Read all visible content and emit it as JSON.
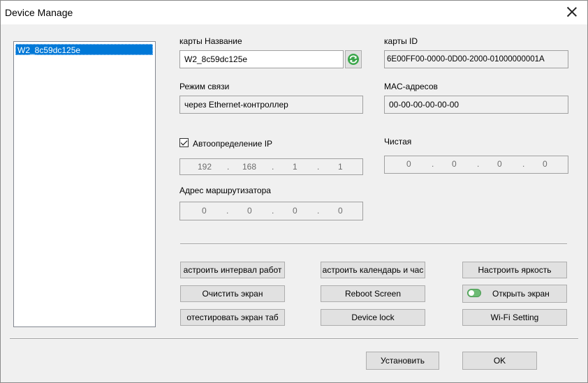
{
  "window": {
    "title": "Device Manage"
  },
  "device_list": {
    "items": [
      "W2_8c59dc125e"
    ]
  },
  "card_name": {
    "label": "карты Название",
    "value": "W2_8c59dc125e"
  },
  "card_id": {
    "label": "карты ID",
    "value": "6E00FF00-0000-0D00-2000-01000000001A"
  },
  "comm_mode": {
    "label": "Режим связи",
    "value": "через Ethernet-контроллер"
  },
  "mac": {
    "label": "MAC-адресов",
    "value": "00-00-00-00-00-00"
  },
  "auto_ip": {
    "label": "Автоопределение IP",
    "checked": true,
    "octets": [
      "192",
      "168",
      "1",
      "1"
    ]
  },
  "clear": {
    "label": "Чистая",
    "octets": [
      "0",
      "0",
      "0",
      "0"
    ]
  },
  "router": {
    "label": "Адрес маршрутизатора",
    "octets": [
      "0",
      "0",
      "0",
      "0"
    ]
  },
  "buttons": {
    "interval": "астроить интервал работ",
    "calendar": "астроить календарь и час",
    "brightness": "Настроить яркость",
    "clear_screen": "Очистить экран",
    "reboot": "Reboot Screen",
    "open_screen": "Открыть экран",
    "test_screen": "отестировать экран таб",
    "device_lock": "Device lock",
    "wifi": "Wi-Fi Setting",
    "install": "Установить",
    "ok": "OK"
  },
  "colors": {
    "selection": "#0078d7",
    "toggle_on": "#6dbb74"
  }
}
